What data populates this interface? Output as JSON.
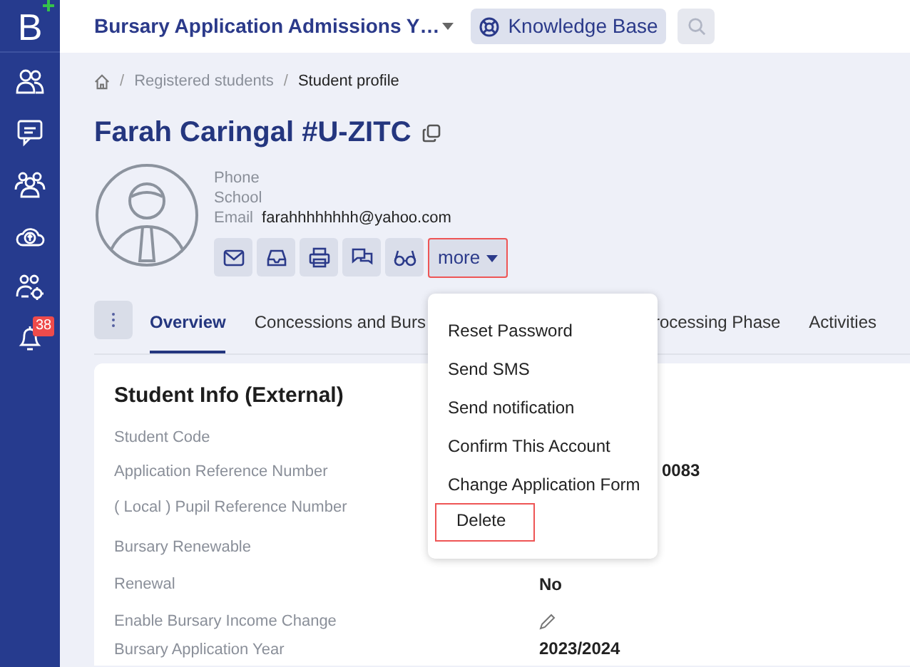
{
  "app_title": "Bursary Application Admissions Y…",
  "knowledge_base": "Knowledge Base",
  "sidebar": {
    "logo": "B",
    "items": [
      {
        "kind": "people"
      },
      {
        "kind": "chat"
      },
      {
        "kind": "group"
      },
      {
        "kind": "cloud"
      },
      {
        "kind": "settings-people"
      },
      {
        "kind": "bell",
        "badge": "38"
      }
    ]
  },
  "breadcrumb": [
    {
      "separator": "/",
      "label": "Registered students",
      "current": false
    },
    {
      "separator": "/",
      "label": "Student profile",
      "current": true
    }
  ],
  "student": {
    "name": "Farah Caringal #U-ZITC",
    "phone_label": "Phone",
    "school_label": "School",
    "email_label": "Email",
    "email": "farahhhhhhhh@yahoo.com"
  },
  "actions": [
    {
      "kind": "mail"
    },
    {
      "kind": "inbox"
    },
    {
      "kind": "print"
    },
    {
      "kind": "chat"
    },
    {
      "kind": "glasses"
    }
  ],
  "more_button": {
    "label": "more",
    "highlighted": true
  },
  "tabs": [
    {
      "label": "Overview",
      "selected": true
    },
    {
      "label": "Concessions and Burs",
      "selected": false
    },
    {
      "label": "rocessing Phase",
      "selected": false
    },
    {
      "label": "Activities",
      "selected": false
    }
  ],
  "menu": [
    {
      "label": "Reset Password",
      "highlighted": false
    },
    {
      "label": "Send SMS",
      "highlighted": false
    },
    {
      "label": "Send notification",
      "highlighted": false
    },
    {
      "label": "Confirm This Account",
      "highlighted": false
    },
    {
      "label": "Change Application Form",
      "highlighted": false
    },
    {
      "label": "Delete",
      "highlighted": true
    }
  ],
  "card": {
    "title": "Student Info (External)",
    "rows": [
      {
        "label": "Student Code",
        "kind": "text",
        "value": ""
      },
      {
        "label": "Application Reference Number",
        "kind": "text",
        "value": "0083"
      },
      {
        "label": "( Local ) Pupil Reference Number",
        "kind": "text",
        "value": ""
      },
      {
        "label": "Bursary Renewable",
        "kind": "text",
        "value": ""
      },
      {
        "label": "Renewal",
        "kind": "text",
        "value": "No"
      },
      {
        "label": "Enable Bursary Income Change",
        "kind": "edit"
      },
      {
        "label": "Bursary Application Year",
        "kind": "text",
        "value": "2023/2024"
      }
    ]
  }
}
